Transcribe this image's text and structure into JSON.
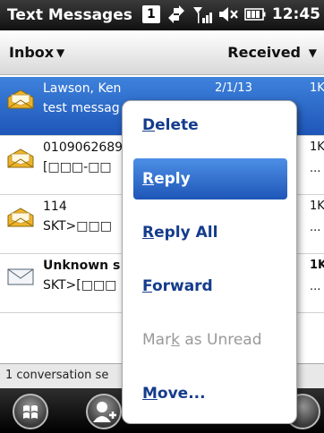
{
  "titlebar": {
    "title": "Text Messages",
    "badge": "1",
    "clock": "12:45"
  },
  "header": {
    "folder_label": "Inbox",
    "sort_label": "Received"
  },
  "messages": [
    {
      "from": "Lawson, Ken",
      "preview": "test messag",
      "date": "2/1/13",
      "size": "1K",
      "more": "",
      "bold": false,
      "selected": true
    },
    {
      "from": "0109062689",
      "preview": "[□□□-□□",
      "date": "",
      "size": "1K",
      "more": "...",
      "bold": false,
      "selected": false
    },
    {
      "from": "114",
      "preview": "SKT>□□□",
      "date": "",
      "size": "1K",
      "more": "...",
      "bold": false,
      "selected": false
    },
    {
      "from": "Unknown s",
      "preview": "SKT>[□□□",
      "date": "",
      "size": "1K",
      "more": "...",
      "bold": true,
      "selected": false
    }
  ],
  "status": {
    "text": "1 conversation se"
  },
  "menu": {
    "items": [
      {
        "pre": "",
        "acc": "D",
        "post": "elete",
        "state": "normal"
      },
      {
        "pre": "",
        "acc": "R",
        "post": "eply",
        "state": "selected"
      },
      {
        "pre": "",
        "acc": "R",
        "post": "eply All",
        "state": "normal"
      },
      {
        "pre": "",
        "acc": "F",
        "post": "orward",
        "state": "normal"
      },
      {
        "pre": "Mar",
        "acc": "k",
        "post": " as Unread",
        "state": "disabled"
      },
      {
        "pre": "",
        "acc": "M",
        "post": "ove...",
        "state": "normal"
      }
    ]
  }
}
